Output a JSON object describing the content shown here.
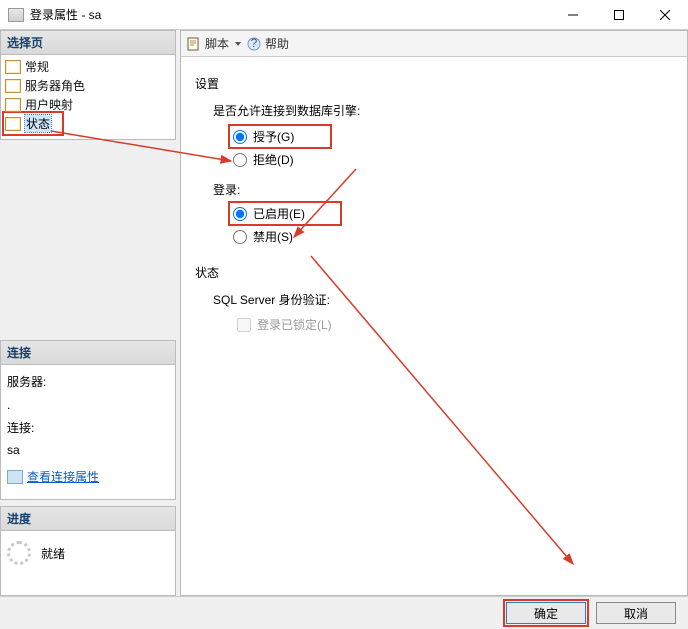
{
  "window": {
    "title": "登录属性 - sa"
  },
  "sidebar": {
    "select_header": "选择页",
    "items": [
      {
        "label": "常规"
      },
      {
        "label": "服务器角色"
      },
      {
        "label": "用户映射"
      },
      {
        "label": "状态",
        "selected": true
      }
    ],
    "connection": {
      "header": "连接",
      "server_label": "服务器:",
      "server_value": ".",
      "conn_label": "连接:",
      "conn_value": "sa",
      "view_props": "查看连接属性"
    },
    "progress": {
      "header": "进度",
      "ready": "就绪"
    }
  },
  "toolbar": {
    "script": "脚本",
    "help": "帮助"
  },
  "main": {
    "settings": "设置",
    "permit_q": "是否允许连接到数据库引擎:",
    "grant": "授予(G)",
    "deny": "拒绝(D)",
    "login_hdr": "登录:",
    "enabled": "已启用(E)",
    "disabled": "禁用(S)",
    "status_hdr": "状态",
    "sqlauth": "SQL Server 身份验证:",
    "locked": "登录已锁定(L)"
  },
  "buttons": {
    "ok": "确定",
    "cancel": "取消"
  }
}
